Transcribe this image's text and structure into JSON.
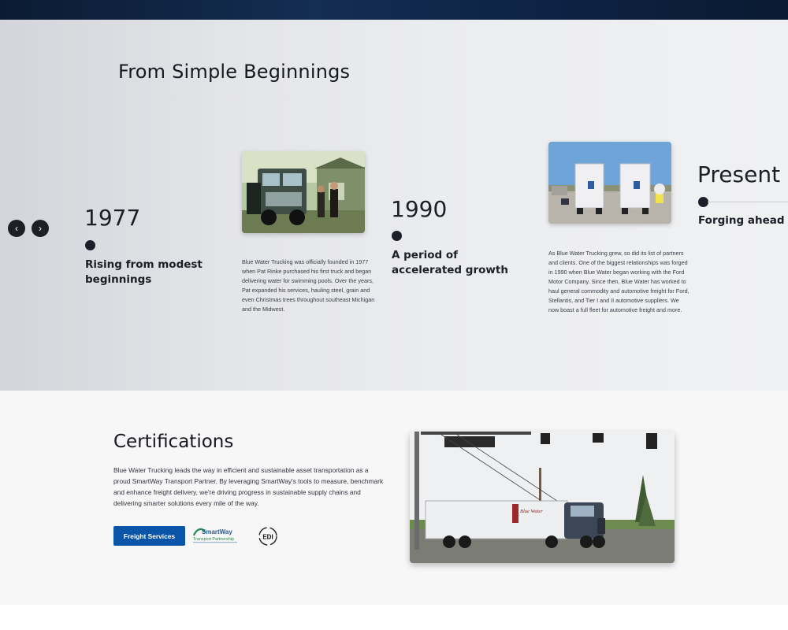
{
  "timeline": {
    "title": "From Simple Beginnings",
    "nav": {
      "prev_icon": "chevron-left-icon",
      "next_icon": "chevron-right-icon",
      "prev_glyph": "‹",
      "next_glyph": "›"
    },
    "items": [
      {
        "year": "1977",
        "headline": "Rising from modest beginnings",
        "description": "Blue Water Trucking was officially founded in 1977 when Pat Rinke purchased his first truck and began delivering water for swimming pools. Over the years, Pat expanded his services, hauling steel, grain and even Christmas trees throughout southeast Michigan and the Midwest."
      },
      {
        "year": "1990",
        "headline": "A period of accelerated growth",
        "description": "As Blue Water Trucking grew, so did its list of partners and clients. One of the biggest relationships was forged in 1990 when Blue Water began working with the Ford Motor Company. Since then, Blue Water has worked to haul general commodity and automotive freight for Ford, Stellantis, and Tier I and II automotive suppliers. We now boast a full fleet for automotive freight and more."
      },
      {
        "year": "Present D",
        "headline": "Forging ahead"
      }
    ]
  },
  "certifications": {
    "title": "Certifications",
    "description": "Blue Water Trucking leads the way in efficient and sustainable asset transportation as a proud SmartWay Transport Partner. By leveraging SmartWay's tools to measure, benchmark and enhance freight delivery, we're driving progress in sustainable supply chains and delivering smarter solutions every mile of the way.",
    "button_label": "Freight Services",
    "logos": {
      "smartway_name": "SmartWay",
      "smartway_sub": "Transport Partnership",
      "edi": "EDI"
    }
  },
  "colors": {
    "accent": "#0a55a8",
    "dark": "#1b1f27",
    "header": "#0b1b33"
  }
}
